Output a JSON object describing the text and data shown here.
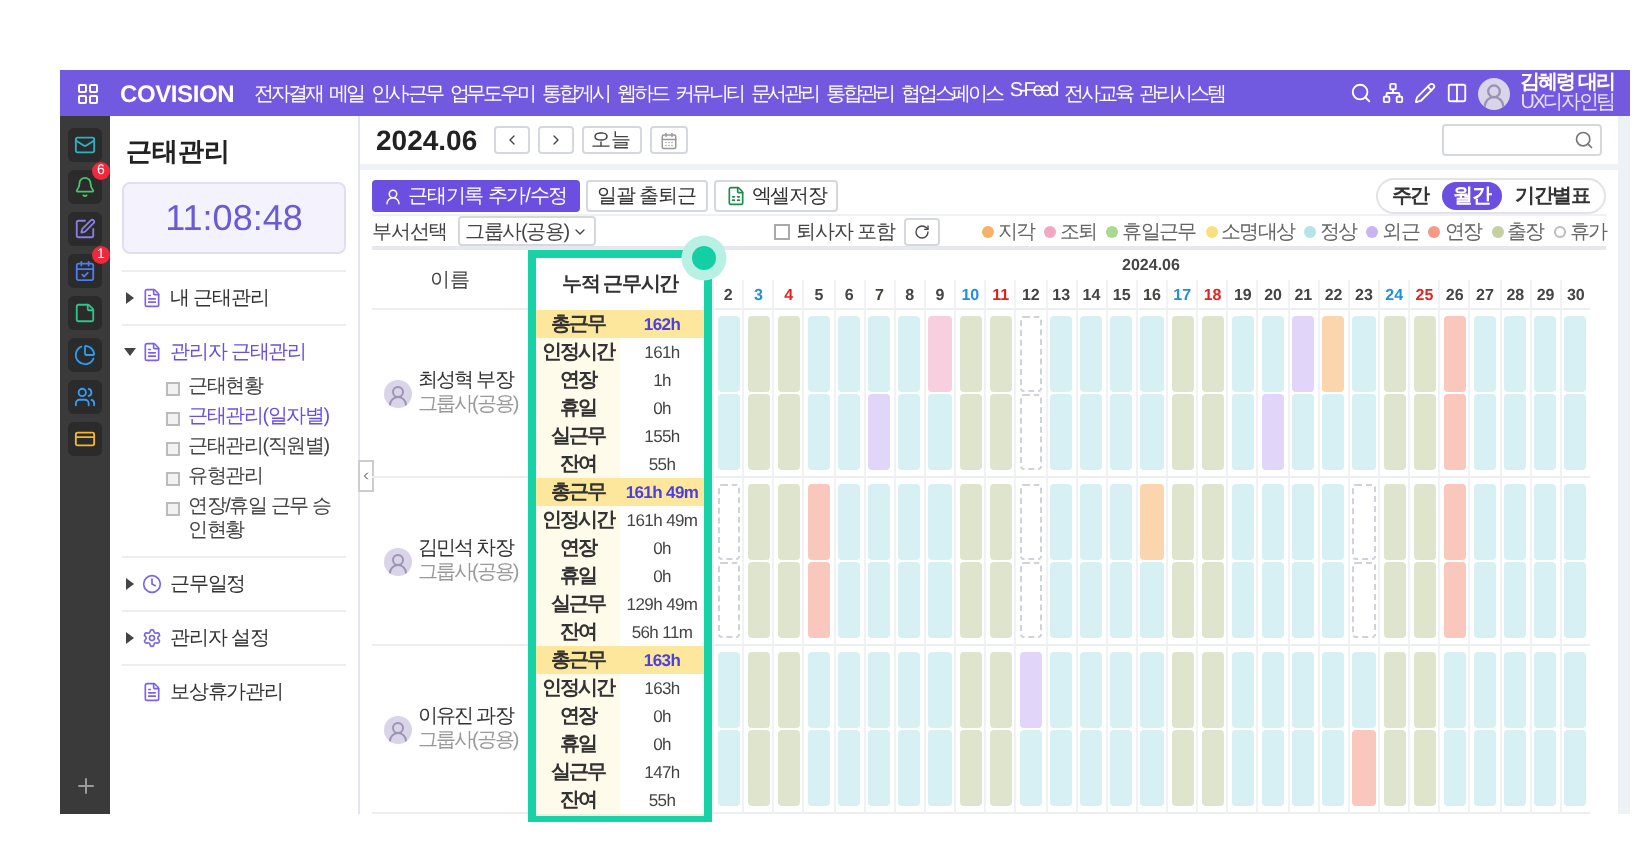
{
  "top_nav": {
    "logo": "COVISION",
    "menu": [
      "전자결재",
      "메일",
      "인사·근무",
      "업무도우미",
      "통합게시",
      "웹하드",
      "커뮤니티",
      "문서관리",
      "통합관리",
      "협업스페이스",
      "S-Feed",
      "전사교육",
      "관리시스템"
    ],
    "user": {
      "name": "김혜령 대리",
      "team": "UX디자인팀"
    }
  },
  "app_bar": [
    {
      "kind": "mail"
    },
    {
      "kind": "bell",
      "badge": "6"
    },
    {
      "kind": "note"
    },
    {
      "kind": "calendar",
      "badge": "1"
    },
    {
      "kind": "memo"
    },
    {
      "kind": "pie"
    },
    {
      "kind": "contacts"
    },
    {
      "kind": "card"
    }
  ],
  "sidebar": {
    "title": "근태관리",
    "clock": "11:08:48",
    "items": [
      {
        "label": "내 근태관리",
        "expanded": false,
        "selected": false
      },
      {
        "label": "관리자 근태관리",
        "expanded": true,
        "selected": true,
        "children": [
          {
            "label": "근태현황",
            "selected": false
          },
          {
            "label": "근태관리(일자별)",
            "selected": true
          },
          {
            "label": "근태관리(직원별)",
            "selected": false
          },
          {
            "label": "유형관리",
            "selected": false
          },
          {
            "label": "연장/휴일 근무 승인현황",
            "selected": false
          }
        ]
      },
      {
        "label": "근무일정",
        "expanded": false,
        "selected": false
      },
      {
        "label": "관리자 설정",
        "expanded": false,
        "selected": false
      },
      {
        "label": "보상휴가관리",
        "selected": false
      }
    ]
  },
  "header": {
    "period": "2024.06",
    "today": "오늘"
  },
  "toolbar": {
    "buttons": [
      {
        "label": "근태기록 추가/수정",
        "kind": "primary"
      },
      {
        "label": "일괄 출퇴근",
        "kind": "plain"
      },
      {
        "label": "엑셀저장",
        "kind": "excel"
      }
    ],
    "views": [
      {
        "label": "주간",
        "selected": false
      },
      {
        "label": "월간",
        "selected": true
      },
      {
        "label": "기간별표",
        "selected": false
      }
    ]
  },
  "filter": {
    "label": "부서선택",
    "department": "그룹사(공용)",
    "resigned": {
      "label": "퇴사자 포함",
      "checked": false
    }
  },
  "legend": [
    {
      "kind": "late",
      "label": "지각",
      "color": "#f7b26a"
    },
    {
      "kind": "early",
      "label": "조퇴",
      "color": "#f2a7c3"
    },
    {
      "kind": "holidaywork",
      "label": "휴일근무",
      "color": "#a8d98e"
    },
    {
      "kind": "review",
      "label": "소명대상",
      "color": "#f9e07f"
    },
    {
      "kind": "normal",
      "label": "정상",
      "color": "#b4e3ea"
    },
    {
      "kind": "outside",
      "label": "외근",
      "color": "#c8b3f4"
    },
    {
      "kind": "overtime",
      "label": "연장",
      "color": "#f59a86"
    },
    {
      "kind": "trip",
      "label": "출장",
      "color": "#c5cfa2"
    },
    {
      "kind": "leave",
      "label": "휴가",
      "color": "#ffffff"
    }
  ],
  "table": {
    "name_header": "이름",
    "month": "2024.06",
    "days": [
      {
        "label": "2",
        "kind": "weekday"
      },
      {
        "label": "3",
        "kind": "sat"
      },
      {
        "label": "4",
        "kind": "sun"
      },
      {
        "label": "5",
        "kind": "weekday"
      },
      {
        "label": "6",
        "kind": "weekday"
      },
      {
        "label": "7",
        "kind": "weekday"
      },
      {
        "label": "8",
        "kind": "weekday"
      },
      {
        "label": "9",
        "kind": "weekday"
      },
      {
        "label": "10",
        "kind": "sat"
      },
      {
        "label": "11",
        "kind": "sun"
      },
      {
        "label": "12",
        "kind": "weekday"
      },
      {
        "label": "13",
        "kind": "weekday"
      },
      {
        "label": "14",
        "kind": "weekday"
      },
      {
        "label": "15",
        "kind": "weekday"
      },
      {
        "label": "16",
        "kind": "weekday"
      },
      {
        "label": "17",
        "kind": "sat"
      },
      {
        "label": "18",
        "kind": "sun"
      },
      {
        "label": "19",
        "kind": "weekday"
      },
      {
        "label": "20",
        "kind": "weekday"
      },
      {
        "label": "21",
        "kind": "weekday"
      },
      {
        "label": "22",
        "kind": "weekday"
      },
      {
        "label": "23",
        "kind": "weekday"
      },
      {
        "label": "24",
        "kind": "sat"
      },
      {
        "label": "25",
        "kind": "sun"
      },
      {
        "label": "26",
        "kind": "weekday"
      },
      {
        "label": "27",
        "kind": "weekday"
      },
      {
        "label": "28",
        "kind": "weekday"
      },
      {
        "label": "29",
        "kind": "weekday"
      },
      {
        "label": "30",
        "kind": "weekday"
      }
    ],
    "people": [
      {
        "name": "최성혁 부장",
        "group": "그룹사(공용)",
        "am": [
          {
            "kind": "normal"
          },
          {
            "kind": "trip"
          },
          {
            "kind": "trip"
          },
          {
            "kind": "normal"
          },
          {
            "kind": "normal"
          },
          {
            "kind": "normal"
          },
          {
            "kind": "normal"
          },
          {
            "kind": "early"
          },
          {
            "kind": "trip"
          },
          {
            "kind": "trip"
          },
          {
            "kind": "leave"
          },
          {
            "kind": "normal"
          },
          {
            "kind": "normal"
          },
          {
            "kind": "normal"
          },
          {
            "kind": "normal"
          },
          {
            "kind": "trip"
          },
          {
            "kind": "trip"
          },
          {
            "kind": "normal"
          },
          {
            "kind": "normal"
          },
          {
            "kind": "outside"
          },
          {
            "kind": "late"
          },
          {
            "kind": "normal"
          },
          {
            "kind": "trip"
          },
          {
            "kind": "trip"
          },
          {
            "kind": "overtime"
          },
          {
            "kind": "normal"
          },
          {
            "kind": "normal"
          },
          {
            "kind": "normal"
          },
          {
            "kind": "normal"
          }
        ],
        "pm": [
          {
            "kind": "normal"
          },
          {
            "kind": "trip"
          },
          {
            "kind": "trip"
          },
          {
            "kind": "normal"
          },
          {
            "kind": "normal"
          },
          {
            "kind": "outside"
          },
          {
            "kind": "normal"
          },
          {
            "kind": "normal"
          },
          {
            "kind": "trip"
          },
          {
            "kind": "trip"
          },
          {
            "kind": "leave"
          },
          {
            "kind": "normal"
          },
          {
            "kind": "normal"
          },
          {
            "kind": "normal"
          },
          {
            "kind": "normal"
          },
          {
            "kind": "trip"
          },
          {
            "kind": "trip"
          },
          {
            "kind": "normal"
          },
          {
            "kind": "outside"
          },
          {
            "kind": "normal"
          },
          {
            "kind": "normal"
          },
          {
            "kind": "normal"
          },
          {
            "kind": "trip"
          },
          {
            "kind": "trip"
          },
          {
            "kind": "overtime"
          },
          {
            "kind": "normal"
          },
          {
            "kind": "normal"
          },
          {
            "kind": "normal"
          },
          {
            "kind": "normal"
          }
        ]
      },
      {
        "name": "김민석 차장",
        "group": "그룹사(공용)",
        "am": [
          {
            "kind": "leave"
          },
          {
            "kind": "trip"
          },
          {
            "kind": "trip"
          },
          {
            "kind": "overtime"
          },
          {
            "kind": "normal"
          },
          {
            "kind": "normal"
          },
          {
            "kind": "normal"
          },
          {
            "kind": "normal"
          },
          {
            "kind": "trip"
          },
          {
            "kind": "trip"
          },
          {
            "kind": "leave"
          },
          {
            "kind": "normal"
          },
          {
            "kind": "normal"
          },
          {
            "kind": "normal"
          },
          {
            "kind": "late"
          },
          {
            "kind": "trip"
          },
          {
            "kind": "trip"
          },
          {
            "kind": "normal"
          },
          {
            "kind": "normal"
          },
          {
            "kind": "normal"
          },
          {
            "kind": "normal"
          },
          {
            "kind": "leave"
          },
          {
            "kind": "trip"
          },
          {
            "kind": "trip"
          },
          {
            "kind": "overtime"
          },
          {
            "kind": "normal"
          },
          {
            "kind": "normal"
          },
          {
            "kind": "normal"
          },
          {
            "kind": "normal"
          }
        ],
        "pm": [
          {
            "kind": "leave"
          },
          {
            "kind": "trip"
          },
          {
            "kind": "trip"
          },
          {
            "kind": "overtime"
          },
          {
            "kind": "normal"
          },
          {
            "kind": "normal"
          },
          {
            "kind": "normal"
          },
          {
            "kind": "normal"
          },
          {
            "kind": "trip"
          },
          {
            "kind": "trip"
          },
          {
            "kind": "leave"
          },
          {
            "kind": "normal"
          },
          {
            "kind": "normal"
          },
          {
            "kind": "normal"
          },
          {
            "kind": "normal"
          },
          {
            "kind": "trip"
          },
          {
            "kind": "trip"
          },
          {
            "kind": "normal"
          },
          {
            "kind": "normal"
          },
          {
            "kind": "normal"
          },
          {
            "kind": "normal"
          },
          {
            "kind": "leave"
          },
          {
            "kind": "trip"
          },
          {
            "kind": "trip"
          },
          {
            "kind": "overtime"
          },
          {
            "kind": "normal"
          },
          {
            "kind": "normal"
          },
          {
            "kind": "normal"
          },
          {
            "kind": "normal"
          }
        ]
      },
      {
        "name": "이유진 과장",
        "group": "그룹사(공용)",
        "am": [
          {
            "kind": "normal"
          },
          {
            "kind": "trip"
          },
          {
            "kind": "trip"
          },
          {
            "kind": "normal"
          },
          {
            "kind": "normal"
          },
          {
            "kind": "normal"
          },
          {
            "kind": "normal"
          },
          {
            "kind": "normal"
          },
          {
            "kind": "trip"
          },
          {
            "kind": "trip"
          },
          {
            "kind": "outside"
          },
          {
            "kind": "normal"
          },
          {
            "kind": "normal"
          },
          {
            "kind": "normal"
          },
          {
            "kind": "normal"
          },
          {
            "kind": "trip"
          },
          {
            "kind": "trip"
          },
          {
            "kind": "normal"
          },
          {
            "kind": "normal"
          },
          {
            "kind": "normal"
          },
          {
            "kind": "normal"
          },
          {
            "kind": "normal"
          },
          {
            "kind": "trip"
          },
          {
            "kind": "trip"
          },
          {
            "kind": "normal"
          },
          {
            "kind": "normal"
          },
          {
            "kind": "normal"
          },
          {
            "kind": "normal"
          },
          {
            "kind": "normal"
          }
        ],
        "pm": [
          {
            "kind": "normal"
          },
          {
            "kind": "trip"
          },
          {
            "kind": "trip"
          },
          {
            "kind": "normal"
          },
          {
            "kind": "normal"
          },
          {
            "kind": "normal"
          },
          {
            "kind": "normal"
          },
          {
            "kind": "normal"
          },
          {
            "kind": "trip"
          },
          {
            "kind": "trip"
          },
          {
            "kind": "normal"
          },
          {
            "kind": "normal"
          },
          {
            "kind": "normal"
          },
          {
            "kind": "normal"
          },
          {
            "kind": "normal"
          },
          {
            "kind": "trip"
          },
          {
            "kind": "trip"
          },
          {
            "kind": "normal"
          },
          {
            "kind": "normal"
          },
          {
            "kind": "normal"
          },
          {
            "kind": "normal"
          },
          {
            "kind": "overtime"
          },
          {
            "kind": "trip"
          },
          {
            "kind": "trip"
          },
          {
            "kind": "normal"
          },
          {
            "kind": "normal"
          },
          {
            "kind": "normal"
          },
          {
            "kind": "normal"
          },
          {
            "kind": "normal"
          }
        ]
      }
    ]
  },
  "summary": {
    "title": "누적 근무시간",
    "groups": [
      {
        "rows": [
          {
            "kind": "total",
            "label": "총근무",
            "value": "162h"
          },
          {
            "kind": "item",
            "label": "인정시간",
            "value": "161h"
          },
          {
            "kind": "item",
            "label": "연장",
            "value": "1h"
          },
          {
            "kind": "item",
            "label": "휴일",
            "value": "0h"
          },
          {
            "kind": "item",
            "label": "실근무",
            "value": "155h"
          },
          {
            "kind": "item",
            "label": "잔여",
            "value": "55h"
          }
        ]
      },
      {
        "rows": [
          {
            "kind": "total",
            "label": "총근무",
            "value": "161h 49m"
          },
          {
            "kind": "item",
            "label": "인정시간",
            "value": "161h 49m"
          },
          {
            "kind": "item",
            "label": "연장",
            "value": "0h"
          },
          {
            "kind": "item",
            "label": "휴일",
            "value": "0h"
          },
          {
            "kind": "item",
            "label": "실근무",
            "value": "129h 49m"
          },
          {
            "kind": "item",
            "label": "잔여",
            "value": "56h 11m"
          }
        ]
      },
      {
        "rows": [
          {
            "kind": "total",
            "label": "총근무",
            "value": "163h"
          },
          {
            "kind": "item",
            "label": "인정시간",
            "value": "163h"
          },
          {
            "kind": "item",
            "label": "연장",
            "value": "0h"
          },
          {
            "kind": "item",
            "label": "휴일",
            "value": "0h"
          },
          {
            "kind": "item",
            "label": "실근무",
            "value": "147h"
          },
          {
            "kind": "item",
            "label": "잔여",
            "value": "55h"
          }
        ]
      }
    ]
  }
}
